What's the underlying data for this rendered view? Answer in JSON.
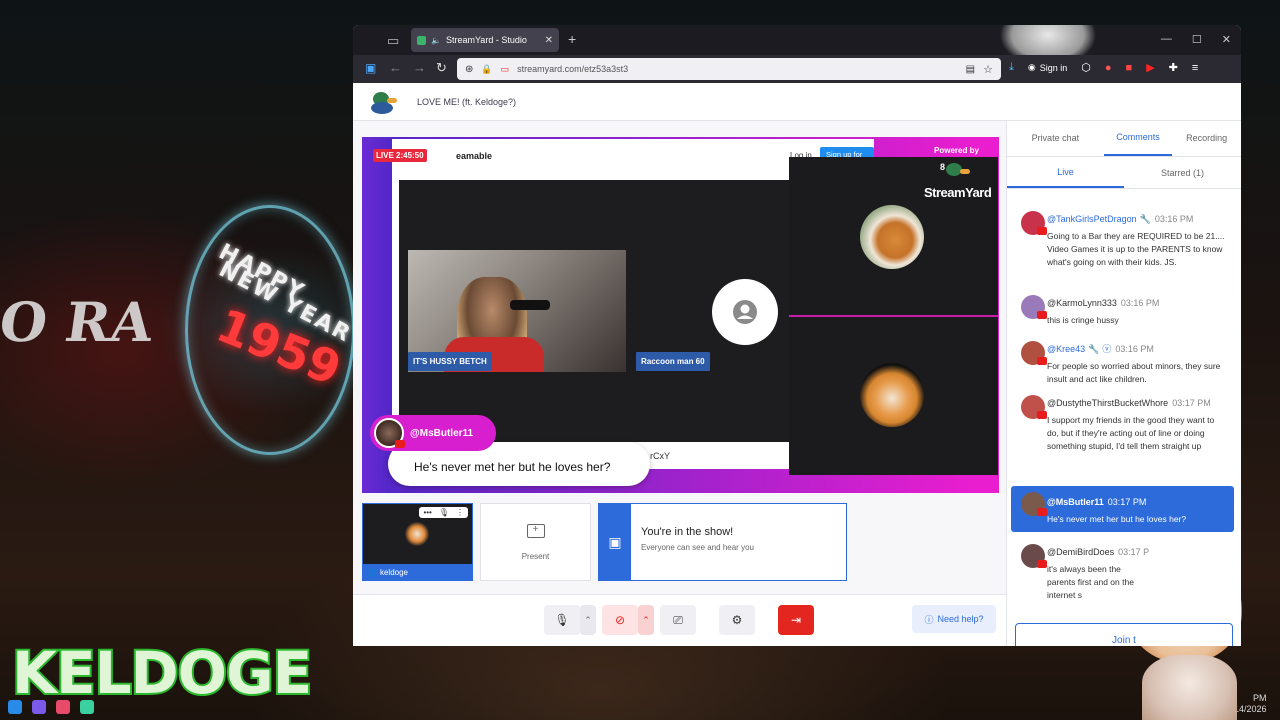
{
  "browser": {
    "tab_title": "StreamYard - Studio",
    "url": "streamyard.com/etz53a3st3",
    "signin_label": "Sign in"
  },
  "header": {
    "show_title": "LOVE ME! (ft. Keldoge?)"
  },
  "stage": {
    "live_badge": "LIVE 2:45:50",
    "site_name": "eamable",
    "login": "Log in",
    "signup": "Sign up for free",
    "powered_by": "Powered by",
    "brand": "StreamYard",
    "brand_badge": "8",
    "participant1_name": "IT'S HUSSY BETCH",
    "participant2_name": "Raccoon man 60",
    "overlay_comment_name": "@MsButler11",
    "overlay_comment_text": "He's never met her but he loves her?",
    "code_fragment": "rCxY"
  },
  "thumbs": {
    "self_name": "keldoge",
    "present_label": "Present",
    "inshow_title": "You're in the show!",
    "inshow_sub": "Everyone can see and hear you"
  },
  "toolbar": {
    "need_help": "Need help?"
  },
  "rpanel": {
    "tabs": [
      {
        "label": "Private chat"
      },
      {
        "label": "Comments"
      },
      {
        "label": "Recording"
      }
    ],
    "subtabs": [
      {
        "label": "Live"
      },
      {
        "label": "Starred (1)"
      }
    ],
    "join_label": "Join t",
    "comments": [
      {
        "name": "@TankGirlsPetDragon",
        "time": "03:16 PM",
        "text": "Going to a Bar they are REQUIRED to be 21.... Video Games it is up to the PARENTS to know what's going on with their kids. JS.",
        "avatar_color": "#c8324a"
      },
      {
        "name": "@KarmoLynn333",
        "time": "03:16 PM",
        "text": "this is cringe hussy",
        "avatar_color": "#9a7ab8"
      },
      {
        "name": "@Kree43",
        "time": "03:16 PM",
        "text": "For people so worried about minors, they sure insult and act like children.",
        "avatar_color": "#b05040"
      },
      {
        "name": "@DustytheThirstBucketWhore",
        "time": "03:17 PM",
        "text": "I support my friends in the good they want to do, but if they're acting out of line or doing something stupid, I'd tell them straight up",
        "avatar_color": "#c0504a"
      },
      {
        "name": "@MsButler11",
        "time": "03:17 PM",
        "text": "He's never met her but he loves her?",
        "avatar_color": "#7a5a4a"
      },
      {
        "name": "@DemiBirdDoes",
        "time": "03:17 P",
        "text": "it's always been the parents first and on the internet s",
        "avatar_color": "#6a4a4a"
      }
    ]
  },
  "desktop": {
    "bg_text": "O RA",
    "neon_line1": "HAPPY",
    "neon_line2": "NEW YEAR",
    "neon_year": "1959",
    "overlay_name": "KELDOGE",
    "clock_time": "PM",
    "clock_date": "14/2026"
  }
}
